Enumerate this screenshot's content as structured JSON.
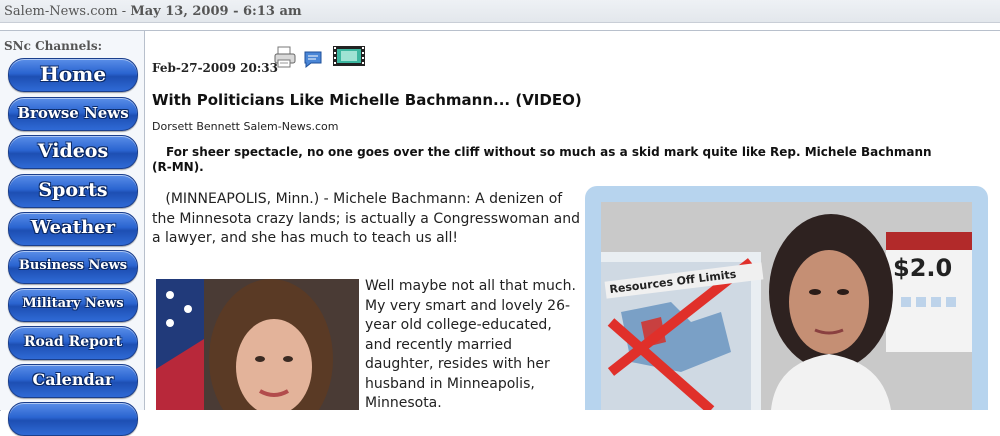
{
  "topbar": {
    "site": "Salem-News.com",
    "sep": " - ",
    "datetime": "May 13, 2009 - 6:13 am"
  },
  "sidebar": {
    "title": "SNc Channels:",
    "items": [
      {
        "label": "Home"
      },
      {
        "label": "Browse News"
      },
      {
        "label": "Videos"
      },
      {
        "label": "Sports"
      },
      {
        "label": "Weather"
      },
      {
        "label": "Business News"
      },
      {
        "label": "Military News"
      },
      {
        "label": "Road Report"
      },
      {
        "label": "Calendar"
      }
    ]
  },
  "article": {
    "dateline": "Feb-27-2009 20:33",
    "icons": [
      "printer-icon",
      "comment-icon",
      "video-icon"
    ],
    "headline": "With Politicians Like Michelle Bachmann... (VIDEO)",
    "byline": "Dorsett Bennett Salem-News.com",
    "summary": "For sheer spectacle, no one goes over the cliff without so much as a skid mark quite like Rep. Michele Bachmann (R-MN).",
    "paragraph1": "(MINNEAPOLIS, Minn.) - Michele Bachmann: A denizen of the Minnesota crazy lands; is actually a Congresswoman and a lawyer, and she has much to teach us all!",
    "paragraph2": "Well maybe not all that much. My very smart and lovely 26-year old college-educated, and recently married daughter, resides with her husband in Minneapolis, Minnesota.",
    "photo2_sign": "Resources Off Limits",
    "photo2_price": "$2.0"
  },
  "colors": {
    "nav_button": "#2a64d0",
    "photo_frame": "#b7d4ee"
  }
}
